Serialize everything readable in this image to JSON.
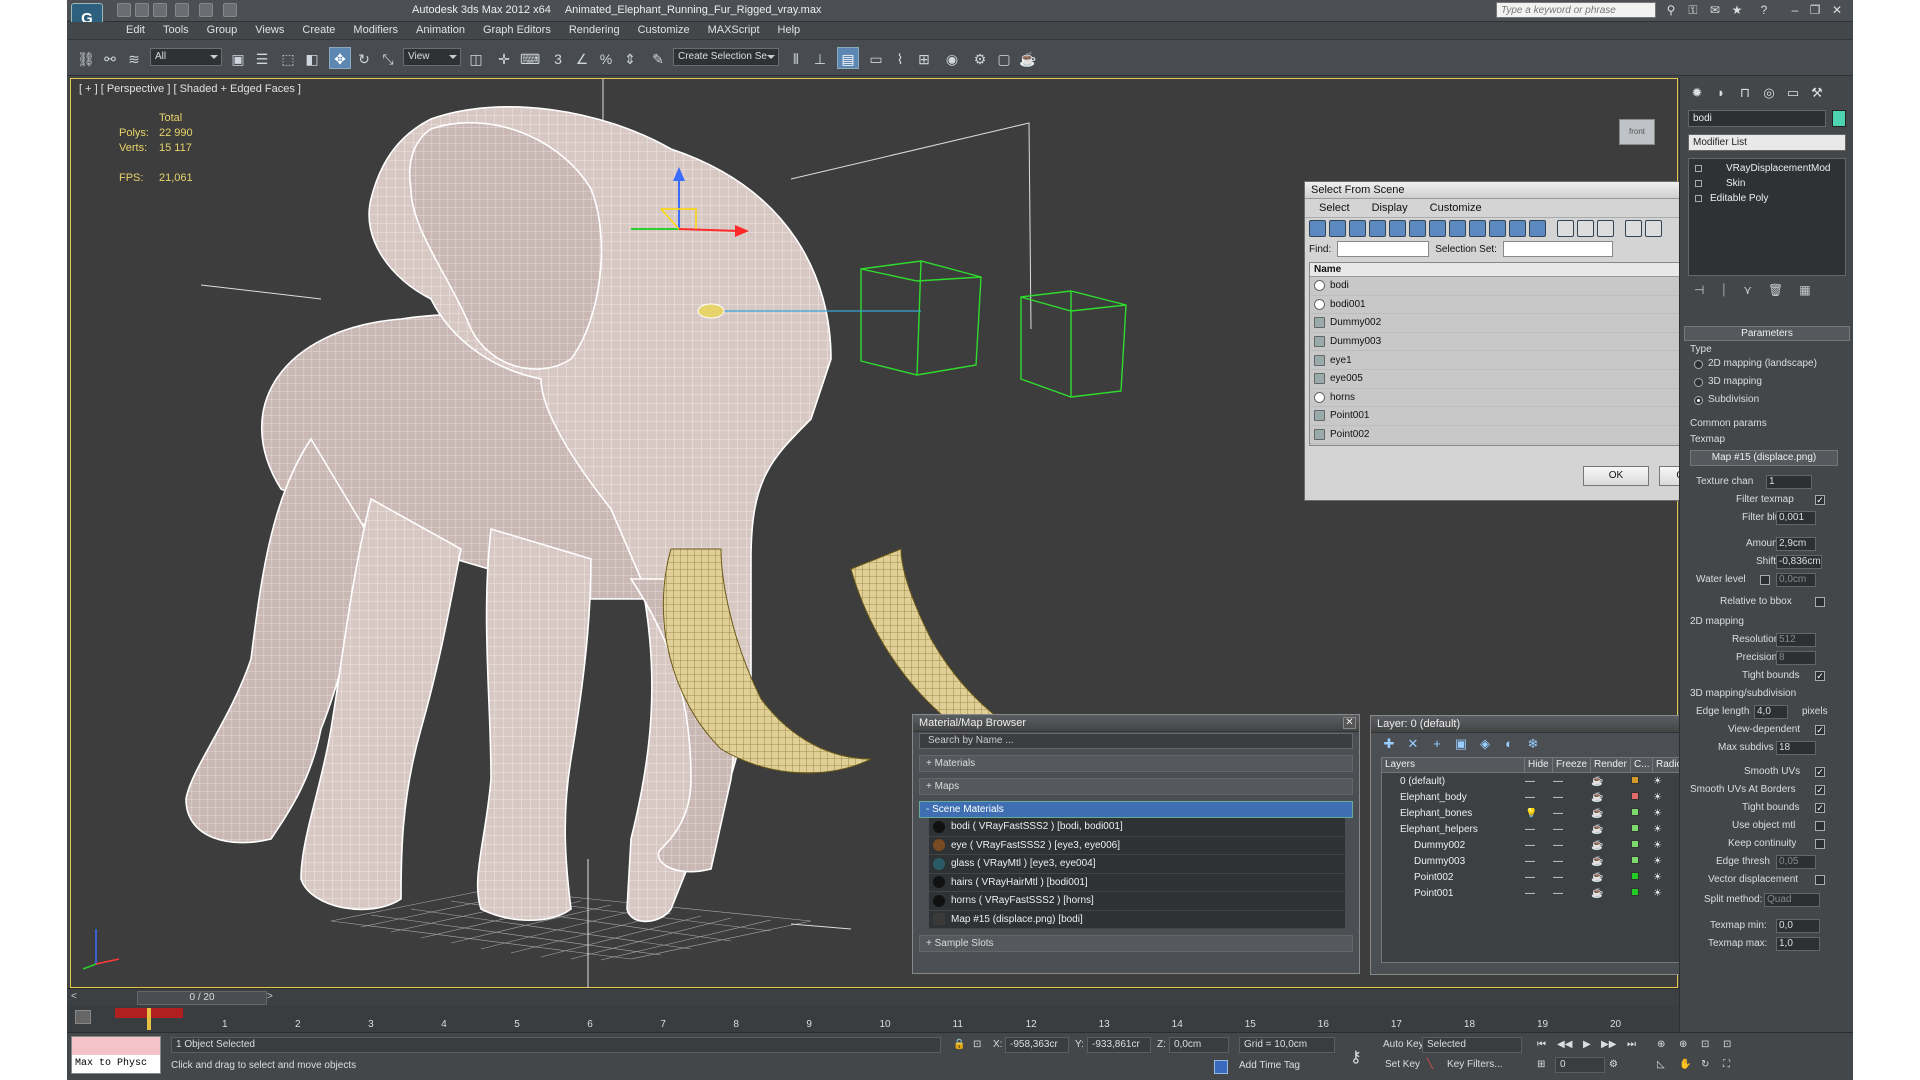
{
  "app": {
    "logo_text": "G",
    "title": "Autodesk 3ds Max  2012 x64",
    "document": "Animated_Elephant_Running_Fur_Rigged_vray.max",
    "search_placeholder": "Type a keyword or phrase"
  },
  "menu": [
    "Edit",
    "Tools",
    "Group",
    "Views",
    "Create",
    "Modifiers",
    "Animation",
    "Graph Editors",
    "Rendering",
    "Customize",
    "MAXScript",
    "Help"
  ],
  "toolbar": {
    "filter_value": "All",
    "ref_coord_value": "View",
    "selection_set_value": "Create Selection Se"
  },
  "viewport": {
    "label": "[ + ] [ Perspective ] [ Shaded + Edged Faces ]",
    "stats": {
      "header": "Total",
      "polys_label": "Polys:",
      "polys": "22 990",
      "verts_label": "Verts:",
      "verts": "15 117",
      "fps_label": "FPS:",
      "fps": "21,061"
    },
    "viewcube_label": "front"
  },
  "select_dialog": {
    "title": "Select From Scene",
    "menu": [
      "Select",
      "Display",
      "Customize"
    ],
    "find_label": "Find:",
    "selection_set_label": "Selection Set:",
    "column_name": "Name",
    "items": [
      "bodi",
      "bodi001",
      "Dummy002",
      "Dummy003",
      "eye1",
      "eye005",
      "horns",
      "Point001",
      "Point002"
    ],
    "ok": "OK",
    "cancel": "Cancel"
  },
  "material_browser": {
    "title": "Material/Map Browser",
    "search_placeholder": "Search by Name ...",
    "sections": {
      "materials": "+ Materials",
      "maps": "+ Maps",
      "scene": "- Scene Materials",
      "sample": "+ Sample Slots"
    },
    "items": [
      {
        "label": "bodi  ( VRayFastSSS2 ) [bodi, bodi001]",
        "swatch": "#111111"
      },
      {
        "label": "eye  ( VRayFastSSS2 ) [eye3, eye006]",
        "swatch": "#7a4a22"
      },
      {
        "label": "glass  ( VRayMtl ) [eye3, eye004]",
        "swatch": "#2a5a66"
      },
      {
        "label": "hairs  ( VRayHairMtl ) [bodi001]",
        "swatch": "#111111"
      },
      {
        "label": "horns  ( VRayFastSSS2 ) [horns]",
        "swatch": "#111111"
      },
      {
        "label": "Map #15 (displace.png) [bodi]",
        "swatch": "#3a3a3a"
      }
    ]
  },
  "layer_dialog": {
    "title": "Layer: 0 (default)",
    "columns": [
      "Layers",
      "Hide",
      "Freeze",
      "Render",
      "C...",
      "Radiosity"
    ],
    "rows": [
      {
        "name": "0 (default)",
        "indent": 0,
        "color": "#d69a2a"
      },
      {
        "name": "Elephant_body",
        "indent": 0,
        "color": "#e06a6a"
      },
      {
        "name": "Elephant_bones",
        "indent": 0,
        "color": "#7bd86f"
      },
      {
        "name": "Elephant_helpers",
        "indent": 0,
        "color": "#7bd86f"
      },
      {
        "name": "Dummy002",
        "indent": 1,
        "color": "#7bd86f"
      },
      {
        "name": "Dummy003",
        "indent": 1,
        "color": "#7bd86f"
      },
      {
        "name": "Point002",
        "indent": 1,
        "color": "#22cc22"
      },
      {
        "name": "Point001",
        "indent": 1,
        "color": "#22cc22"
      }
    ]
  },
  "command_panel": {
    "object_name": "bodi",
    "object_color": "#4ed3b1",
    "modifier_list": "Modifier List",
    "stack": [
      "VRayDisplacementMod",
      "Skin",
      "Editable Poly"
    ],
    "params": {
      "header": "Parameters",
      "type_label": "Type",
      "type_2d": "2D mapping (landscape)",
      "type_3d": "3D mapping",
      "type_sub": "Subdivision",
      "common_label": "Common params",
      "texmap_label": "Texmap",
      "texmap_button": "Map #15 (displace.png)",
      "texture_chan_label": "Texture chan",
      "texture_chan": "1",
      "filter_texmap_label": "Filter texmap",
      "filter_blur_label": "Filter blur",
      "filter_blur": "0,001",
      "amount_label": "Amount",
      "amount": "2,9cm",
      "shift_label": "Shift",
      "shift": "-0,836cm",
      "water_label": "Water level",
      "water": "0,0cm",
      "relative_label": "Relative to bbox",
      "mapping2d_label": "2D mapping",
      "resolution_label": "Resolution",
      "resolution": "512",
      "precision_label": "Precision",
      "precision": "8",
      "tight_label": "Tight bounds",
      "mapping3d_label": "3D mapping/subdivision",
      "edge_len_label": "Edge length",
      "edge_len": "4,0",
      "pixels": "pixels",
      "view_dep_label": "View-dependent",
      "max_subdivs_label": "Max subdivs",
      "max_subdivs": "18",
      "smooth_uvs_label": "Smooth UVs",
      "smooth_borders_label": "Smooth UVs At Borders",
      "tight2_label": "Tight bounds",
      "use_obj_mtl_label": "Use object mtl",
      "keep_cont_label": "Keep continuity",
      "edge_thresh_label": "Edge thresh",
      "edge_thresh": "0,05",
      "vector_disp_label": "Vector displacement",
      "split_label": "Split method:",
      "split": "Quad",
      "texmap_min_label": "Texmap min:",
      "texmap_min": "0,0",
      "texmap_max_label": "Texmap max:",
      "texmap_max": "1,0"
    }
  },
  "timeline": {
    "frame_readout": "0 / 20",
    "ticks": [
      "1",
      "2",
      "3",
      "4",
      "5",
      "6",
      "7",
      "8",
      "9",
      "10",
      "11",
      "12",
      "13",
      "14",
      "15",
      "16",
      "17",
      "18",
      "19",
      "20"
    ]
  },
  "status": {
    "maxscript": "Max to Physc",
    "selected": "1 Object Selected",
    "prompt": "Click and drag to select and move objects",
    "x_label": "X:",
    "x": "-958,363cr",
    "y_label": "Y:",
    "y": "-933,861cr",
    "z_label": "Z:",
    "z": "0,0cm",
    "grid": "Grid = 10,0cm",
    "auto_key": "Auto Key",
    "set_key": "Set Key",
    "key_mode": "Selected",
    "key_filters": "Key Filters...",
    "add_time_tag": "Add Time Tag",
    "frame": "0"
  }
}
